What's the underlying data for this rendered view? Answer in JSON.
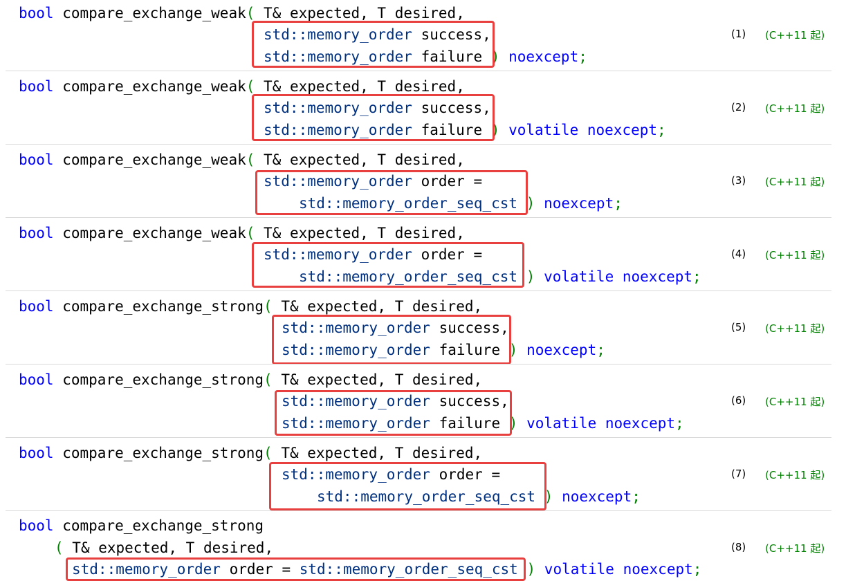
{
  "kw": {
    "bool": "bool",
    "weak": "compare_exchange_weak",
    "strong": "compare_exchange_strong",
    "std": "std::",
    "memory_order": "memory_order",
    "seq_cst": "memory_order_seq_cst",
    "noexcept": "noexcept",
    "volatile": "volatile"
  },
  "rows": [
    {
      "num": "(1)",
      "since": "(C++11 起)"
    },
    {
      "num": "(2)",
      "since": "(C++11 起)"
    },
    {
      "num": "(3)",
      "since": "(C++11 起)"
    },
    {
      "num": "(4)",
      "since": "(C++11 起)"
    },
    {
      "num": "(5)",
      "since": "(C++11 起)"
    },
    {
      "num": "(6)",
      "since": "(C++11 起)"
    },
    {
      "num": "(7)",
      "since": "(C++11 起)"
    },
    {
      "num": "(8)",
      "since": "(C++11 起)"
    }
  ],
  "text": {
    "paren_open": "(",
    "params": " T& expected, T desired,",
    "success": " success,",
    "failure": " failure",
    "order_eq": " order =",
    "order_eq_full": " order = ",
    "close": ")",
    "semi": ";",
    "space": " "
  }
}
